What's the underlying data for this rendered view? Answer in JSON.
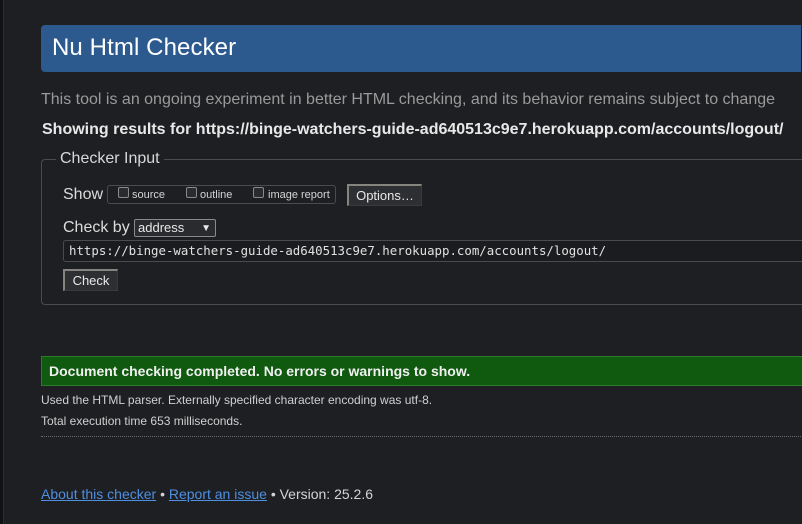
{
  "header": {
    "title": "Nu Html Checker"
  },
  "intro_text": "This tool is an ongoing experiment in better HTML checking, and its behavior remains subject to change",
  "showing_results": "Showing results for https://binge-watchers-guide-ad640513c9e7.herokuapp.com/accounts/logout/",
  "checker_input": {
    "legend": "Checker Input",
    "show_label": "Show",
    "options": [
      {
        "label": "source",
        "checked": false
      },
      {
        "label": "outline",
        "checked": false
      },
      {
        "label": "image report",
        "checked": false
      }
    ],
    "options_button": "Options…",
    "check_by_label": "Check by",
    "check_by_selected": "address",
    "url_value": "https://binge-watchers-guide-ad640513c9e7.herokuapp.com/accounts/logout/",
    "check_button": "Check"
  },
  "result": {
    "success_message": "Document checking completed. No errors or warnings to show.",
    "parser_info": "Used the HTML parser. Externally specified character encoding was utf-8.",
    "execution_time": "Total execution time 653 milliseconds."
  },
  "footer": {
    "about_link": "About this checker",
    "separator": "•",
    "report_link": "Report an issue",
    "version_text": "Version: 25.2.6"
  },
  "colors": {
    "title_bar": "#2d5a8e",
    "success_bg": "#0f5a0f",
    "link": "#4e8fe0",
    "page_bg": "#1e1f22"
  }
}
